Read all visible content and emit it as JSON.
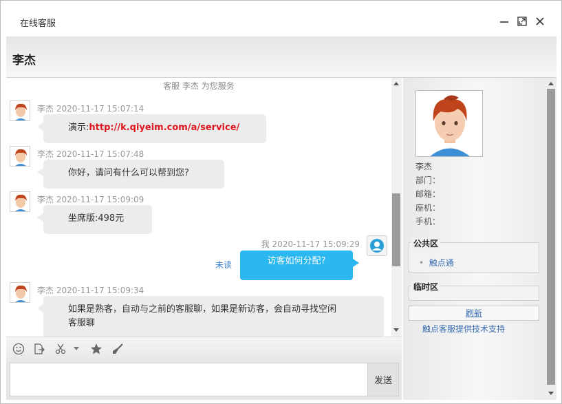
{
  "window": {
    "title": "在线客服"
  },
  "header": {
    "contact_name": "李杰"
  },
  "chat": {
    "service_bar": "客服 李杰 为您服务",
    "messages": [
      {
        "sender": "李杰",
        "time": "2020-11-17 15:07:14",
        "prefix": "演示:",
        "link": "http://k.qiyeim.com/a/service/"
      },
      {
        "sender": "李杰",
        "time": "2020-11-17 15:07:48",
        "text": "你好，请问有什么可以帮到您?"
      },
      {
        "sender": "李杰",
        "time": "2020-11-17 15:09:09",
        "text": "坐席版:498元"
      },
      {
        "sender": "李杰",
        "time": "2020-11-17 15:09:34",
        "text_line1": "如果是熟客，自动与之前的客服聊，如果是新访客，会自动寻找空闲",
        "text_line2": "客服聊"
      }
    ],
    "my_message": {
      "sender": "我",
      "time": "2020-11-17 15:09:29",
      "text": "访客如何分配?",
      "status": "未读"
    }
  },
  "composer": {
    "input_value": "",
    "send_label": "发送"
  },
  "side": {
    "name": "李杰",
    "dept_label": "部门：",
    "email_label": "邮箱：",
    "phone_label": "座机：",
    "mobile_label": "手机：",
    "public_title": "公共区",
    "public_items": [
      "触点通"
    ],
    "temp_title": "临时区",
    "refresh_label": "刷新",
    "support_text": "触点客服提供技术支持"
  },
  "colors": {
    "my_bubble": "#2bb7ef",
    "link_red": "#e0161f",
    "link_blue": "#3a6fb5"
  }
}
